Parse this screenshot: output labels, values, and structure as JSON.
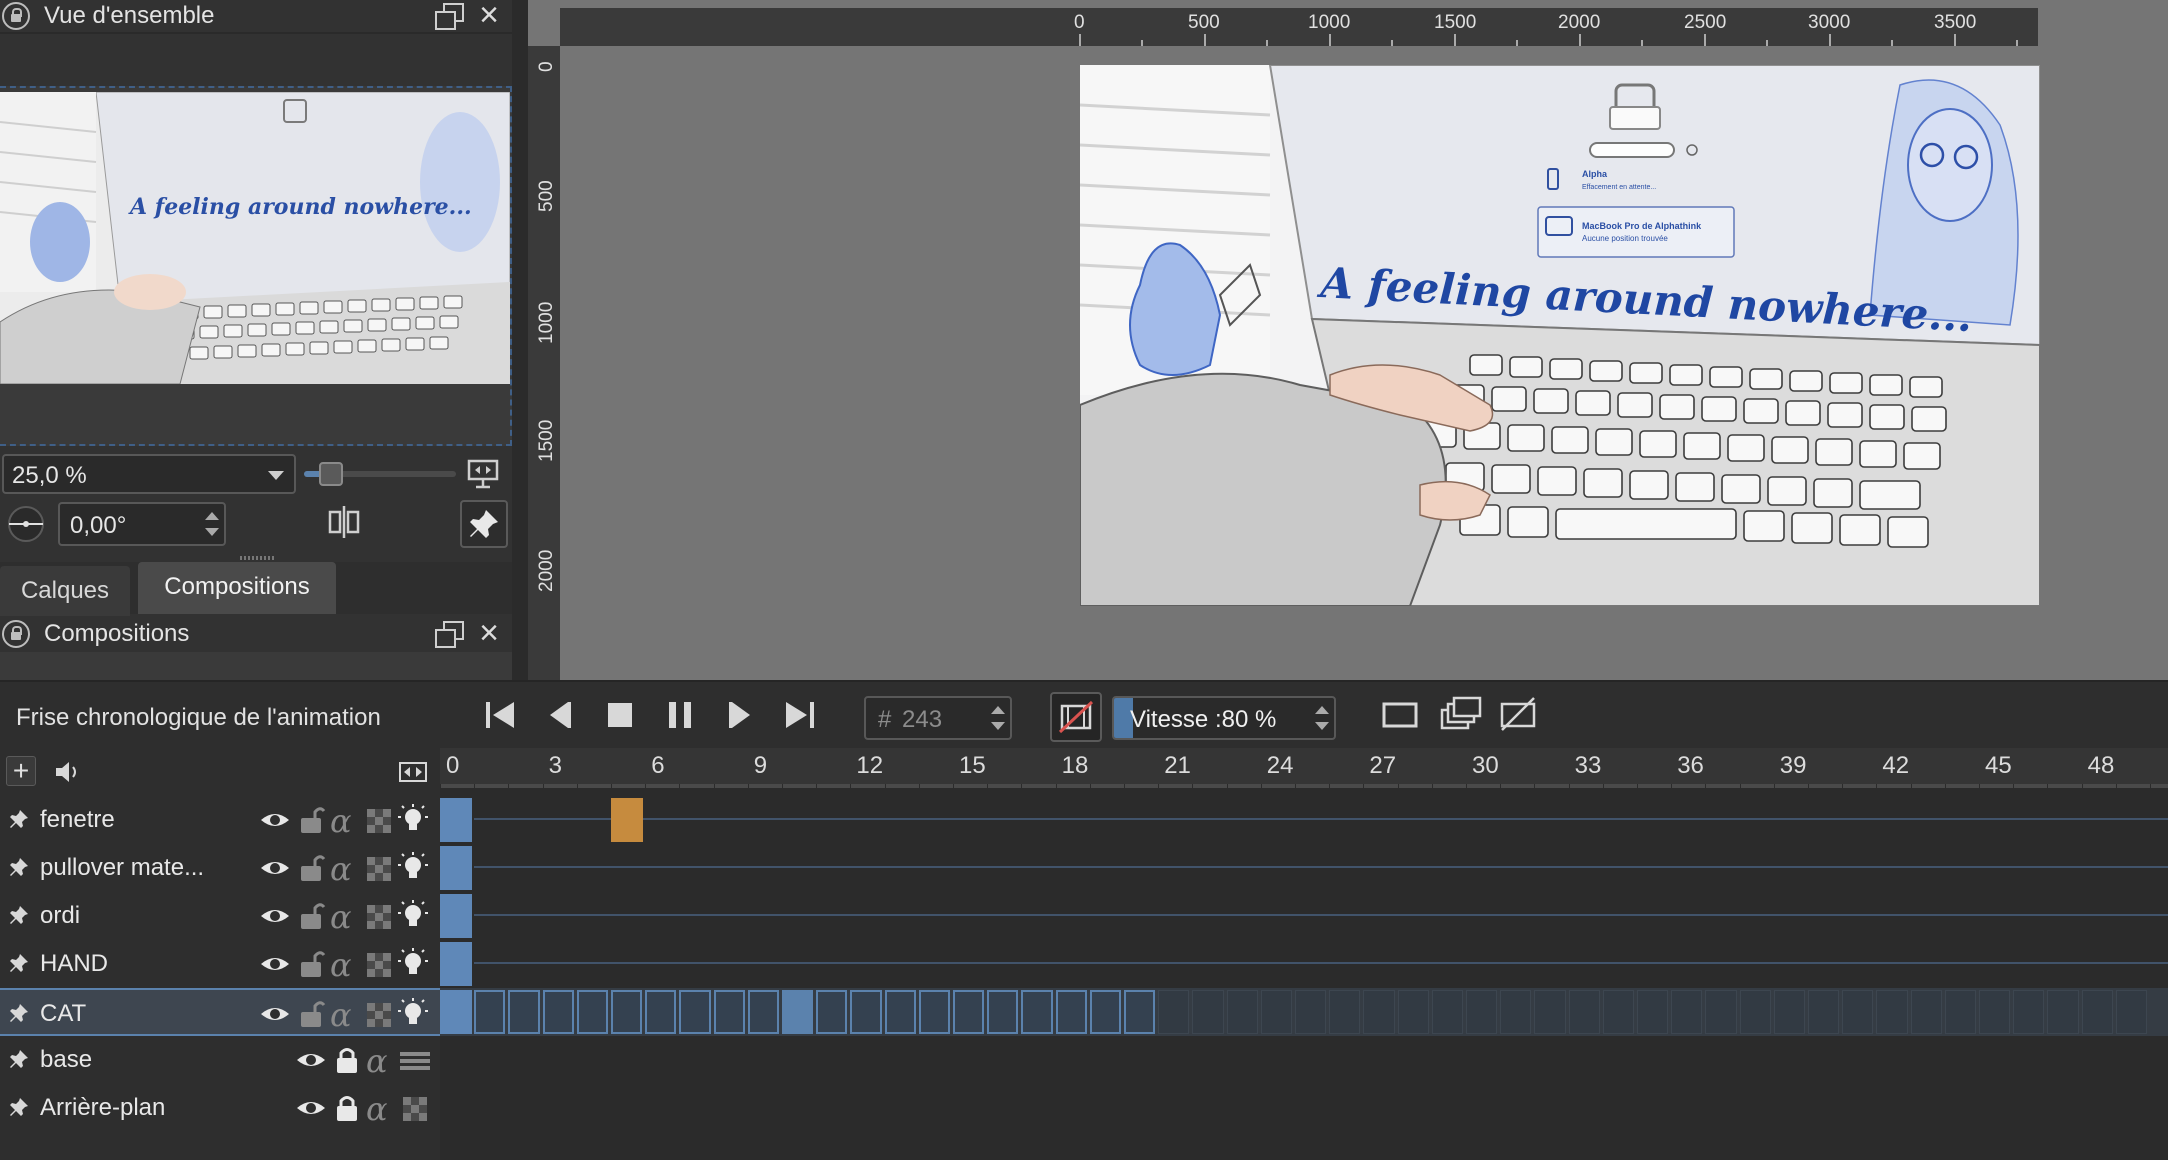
{
  "overview": {
    "title": "Vue d'ensemble"
  },
  "zoom": {
    "value": "25,0 %",
    "slider": 0.18
  },
  "rotation": {
    "value": "0,00°"
  },
  "tabs": [
    {
      "label": "Calques"
    },
    {
      "label": "Compositions"
    }
  ],
  "compositions": {
    "title": "Compositions"
  },
  "ruler": {
    "h_labels": [
      "0",
      "500",
      "1000",
      "1500",
      "2000",
      "2500",
      "3000",
      "3500"
    ],
    "v_labels": [
      "0",
      "500",
      "1000",
      "1500",
      "2000"
    ]
  },
  "artwork": {
    "caption": "A feeling around nowhere...",
    "popup_line1": "Alpha",
    "popup_line2": "Effacement en attente...",
    "popup_line3": "MacBook Pro de Alphathink",
    "popup_line4": "Aucune position trouvée"
  },
  "timeline": {
    "title": "Frise chronologique de l'animation",
    "frame_prefix": "#",
    "frame_value": "243",
    "speed_label": "Vitesse :80 %",
    "speed_fraction": 0.8,
    "frame_numbers": [
      "0",
      "3",
      "6",
      "9",
      "12",
      "15",
      "18",
      "21",
      "24",
      "27",
      "30",
      "33",
      "36",
      "39",
      "42",
      "45",
      "48"
    ],
    "layers": [
      {
        "name": "fenetre",
        "selected": false,
        "keyframes": [
          0,
          5
        ],
        "locked": false
      },
      {
        "name": "pullover mate...",
        "selected": false,
        "keyframes": [
          0
        ],
        "locked": false
      },
      {
        "name": "ordi",
        "selected": false,
        "keyframes": [
          0
        ],
        "locked": false
      },
      {
        "name": "HAND",
        "selected": false,
        "keyframes": [
          0
        ],
        "locked": false
      },
      {
        "name": "CAT",
        "selected": true,
        "keyframes": [
          0
        ],
        "locked": false
      },
      {
        "name": "base",
        "selected": false,
        "keyframes": [],
        "locked": true
      },
      {
        "name": "Arrière-plan",
        "selected": false,
        "keyframes": [],
        "locked": true
      }
    ]
  },
  "colors": {
    "accent": "#5b82ad",
    "keyframe": "#5f88b8",
    "onion_frame": "#c68b3e",
    "panel": "#323232",
    "canvas": "#757575"
  }
}
